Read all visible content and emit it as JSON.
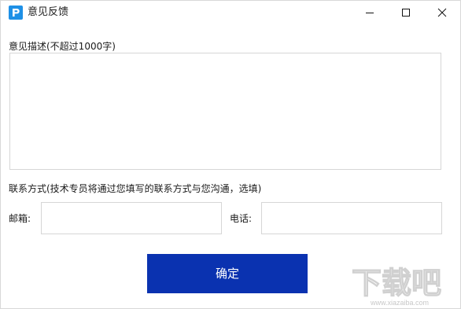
{
  "window": {
    "title": "意见反馈",
    "app_icon": "p-logo-icon",
    "controls": [
      "minimize-icon",
      "maximize-icon",
      "close-icon"
    ]
  },
  "form": {
    "description_label": "意见描述(不超过1000字)",
    "description_value": "",
    "contact_label": "联系方式(技术专员将通过您填写的联系方式与您沟通，选填)",
    "email_label": "邮箱:",
    "email_value": "",
    "phone_label": "电话:",
    "phone_value": "",
    "confirm_label": "确定"
  },
  "watermark": {
    "main_text": "下载吧",
    "url_text": "www.xiazaiba.com"
  },
  "colors": {
    "accent": "#0a32b0",
    "app_icon": "#1e90e6",
    "border": "#d6d6d6"
  }
}
